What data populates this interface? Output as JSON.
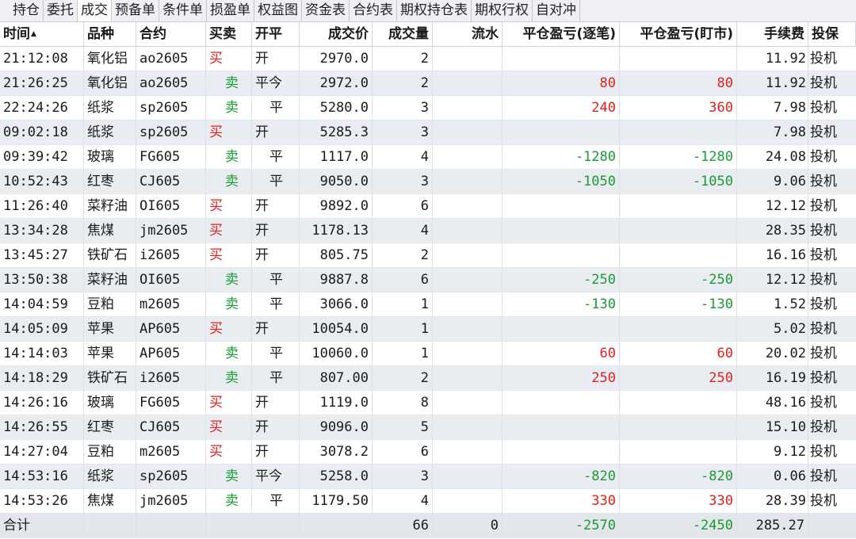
{
  "tabs": [
    {
      "label": "持仓",
      "active": false
    },
    {
      "label": "委托",
      "active": false
    },
    {
      "label": "成交",
      "active": true
    },
    {
      "label": "预备单",
      "active": false
    },
    {
      "label": "条件单",
      "active": false
    },
    {
      "label": "损盈单",
      "active": false
    },
    {
      "label": "权益图",
      "active": false
    },
    {
      "label": "资金表",
      "active": false
    },
    {
      "label": "合约表",
      "active": false
    },
    {
      "label": "期权持仓表",
      "active": false
    },
    {
      "label": "期权行权",
      "active": false
    },
    {
      "label": "自对冲",
      "active": false
    }
  ],
  "columns": [
    "时间",
    "品种",
    "合约",
    "买卖",
    "开平",
    "成交价",
    "成交量",
    "流水",
    "平仓盈亏(逐笔)",
    "平仓盈亏(盯市)",
    "手续费",
    "投保"
  ],
  "sort_indicator": "▲",
  "colors": {
    "buy": "#e0201c",
    "sell": "#1a9a33",
    "profit": "#e0201c",
    "loss": "#1a9a33"
  },
  "rows": [
    {
      "time": "21:12:08",
      "product": "氧化铝",
      "contract": "ao2605",
      "side": "买",
      "oc": "开",
      "price": "2970.0",
      "qty": "2",
      "flow": "",
      "pnl_trade": "",
      "pnl_mtm": "",
      "fee": "11.92",
      "hedge": "投机"
    },
    {
      "time": "21:26:25",
      "product": "氧化铝",
      "contract": "ao2605",
      "side": "卖",
      "oc": "平今",
      "price": "2972.0",
      "qty": "2",
      "flow": "",
      "pnl_trade": "80",
      "pnl_mtm": "80",
      "fee": "11.92",
      "hedge": "投机"
    },
    {
      "time": "22:24:26",
      "product": "纸浆",
      "contract": "sp2605",
      "side": "卖",
      "oc": "平",
      "price": "5280.0",
      "qty": "3",
      "flow": "",
      "pnl_trade": "240",
      "pnl_mtm": "360",
      "fee": "7.98",
      "hedge": "投机"
    },
    {
      "time": "09:02:18",
      "product": "纸浆",
      "contract": "sp2605",
      "side": "买",
      "oc": "开",
      "price": "5285.3",
      "qty": "3",
      "flow": "",
      "pnl_trade": "",
      "pnl_mtm": "",
      "fee": "7.98",
      "hedge": "投机"
    },
    {
      "time": "09:39:42",
      "product": "玻璃",
      "contract": "FG605",
      "side": "卖",
      "oc": "平",
      "price": "1117.0",
      "qty": "4",
      "flow": "",
      "pnl_trade": "-1280",
      "pnl_mtm": "-1280",
      "fee": "24.08",
      "hedge": "投机"
    },
    {
      "time": "10:52:43",
      "product": "红枣",
      "contract": "CJ605",
      "side": "卖",
      "oc": "平",
      "price": "9050.0",
      "qty": "3",
      "flow": "",
      "pnl_trade": "-1050",
      "pnl_mtm": "-1050",
      "fee": "9.06",
      "hedge": "投机"
    },
    {
      "time": "11:26:40",
      "product": "菜籽油",
      "contract": "OI605",
      "side": "买",
      "oc": "开",
      "price": "9892.0",
      "qty": "6",
      "flow": "",
      "pnl_trade": "",
      "pnl_mtm": "",
      "fee": "12.12",
      "hedge": "投机"
    },
    {
      "time": "13:34:28",
      "product": "焦煤",
      "contract": "jm2605",
      "side": "买",
      "oc": "开",
      "price": "1178.13",
      "qty": "4",
      "flow": "",
      "pnl_trade": "",
      "pnl_mtm": "",
      "fee": "28.35",
      "hedge": "投机"
    },
    {
      "time": "13:45:27",
      "product": "铁矿石",
      "contract": "i2605",
      "side": "买",
      "oc": "开",
      "price": "805.75",
      "qty": "2",
      "flow": "",
      "pnl_trade": "",
      "pnl_mtm": "",
      "fee": "16.16",
      "hedge": "投机"
    },
    {
      "time": "13:50:38",
      "product": "菜籽油",
      "contract": "OI605",
      "side": "卖",
      "oc": "平",
      "price": "9887.8",
      "qty": "6",
      "flow": "",
      "pnl_trade": "-250",
      "pnl_mtm": "-250",
      "fee": "12.12",
      "hedge": "投机"
    },
    {
      "time": "14:04:59",
      "product": "豆粕",
      "contract": "m2605",
      "side": "卖",
      "oc": "平",
      "price": "3066.0",
      "qty": "1",
      "flow": "",
      "pnl_trade": "-130",
      "pnl_mtm": "-130",
      "fee": "1.52",
      "hedge": "投机"
    },
    {
      "time": "14:05:09",
      "product": "苹果",
      "contract": "AP605",
      "side": "买",
      "oc": "开",
      "price": "10054.0",
      "qty": "1",
      "flow": "",
      "pnl_trade": "",
      "pnl_mtm": "",
      "fee": "5.02",
      "hedge": "投机"
    },
    {
      "time": "14:14:03",
      "product": "苹果",
      "contract": "AP605",
      "side": "卖",
      "oc": "平",
      "price": "10060.0",
      "qty": "1",
      "flow": "",
      "pnl_trade": "60",
      "pnl_mtm": "60",
      "fee": "20.02",
      "hedge": "投机"
    },
    {
      "time": "14:18:29",
      "product": "铁矿石",
      "contract": "i2605",
      "side": "卖",
      "oc": "平",
      "price": "807.00",
      "qty": "2",
      "flow": "",
      "pnl_trade": "250",
      "pnl_mtm": "250",
      "fee": "16.19",
      "hedge": "投机"
    },
    {
      "time": "14:26:16",
      "product": "玻璃",
      "contract": "FG605",
      "side": "买",
      "oc": "开",
      "price": "1119.0",
      "qty": "8",
      "flow": "",
      "pnl_trade": "",
      "pnl_mtm": "",
      "fee": "48.16",
      "hedge": "投机"
    },
    {
      "time": "14:26:55",
      "product": "红枣",
      "contract": "CJ605",
      "side": "买",
      "oc": "开",
      "price": "9096.0",
      "qty": "5",
      "flow": "",
      "pnl_trade": "",
      "pnl_mtm": "",
      "fee": "15.10",
      "hedge": "投机"
    },
    {
      "time": "14:27:04",
      "product": "豆粕",
      "contract": "m2605",
      "side": "买",
      "oc": "开",
      "price": "3078.2",
      "qty": "6",
      "flow": "",
      "pnl_trade": "",
      "pnl_mtm": "",
      "fee": "9.12",
      "hedge": "投机"
    },
    {
      "time": "14:53:16",
      "product": "纸浆",
      "contract": "sp2605",
      "side": "卖",
      "oc": "平今",
      "price": "5258.0",
      "qty": "3",
      "flow": "",
      "pnl_trade": "-820",
      "pnl_mtm": "-820",
      "fee": "0.06",
      "hedge": "投机"
    },
    {
      "time": "14:53:26",
      "product": "焦煤",
      "contract": "jm2605",
      "side": "卖",
      "oc": "平",
      "price": "1179.50",
      "qty": "4",
      "flow": "",
      "pnl_trade": "330",
      "pnl_mtm": "330",
      "fee": "28.39",
      "hedge": "投机"
    }
  ],
  "total": {
    "label": "合计",
    "qty": "66",
    "flow": "0",
    "pnl_trade": "-2570",
    "pnl_mtm": "-2450",
    "fee": "285.27"
  }
}
